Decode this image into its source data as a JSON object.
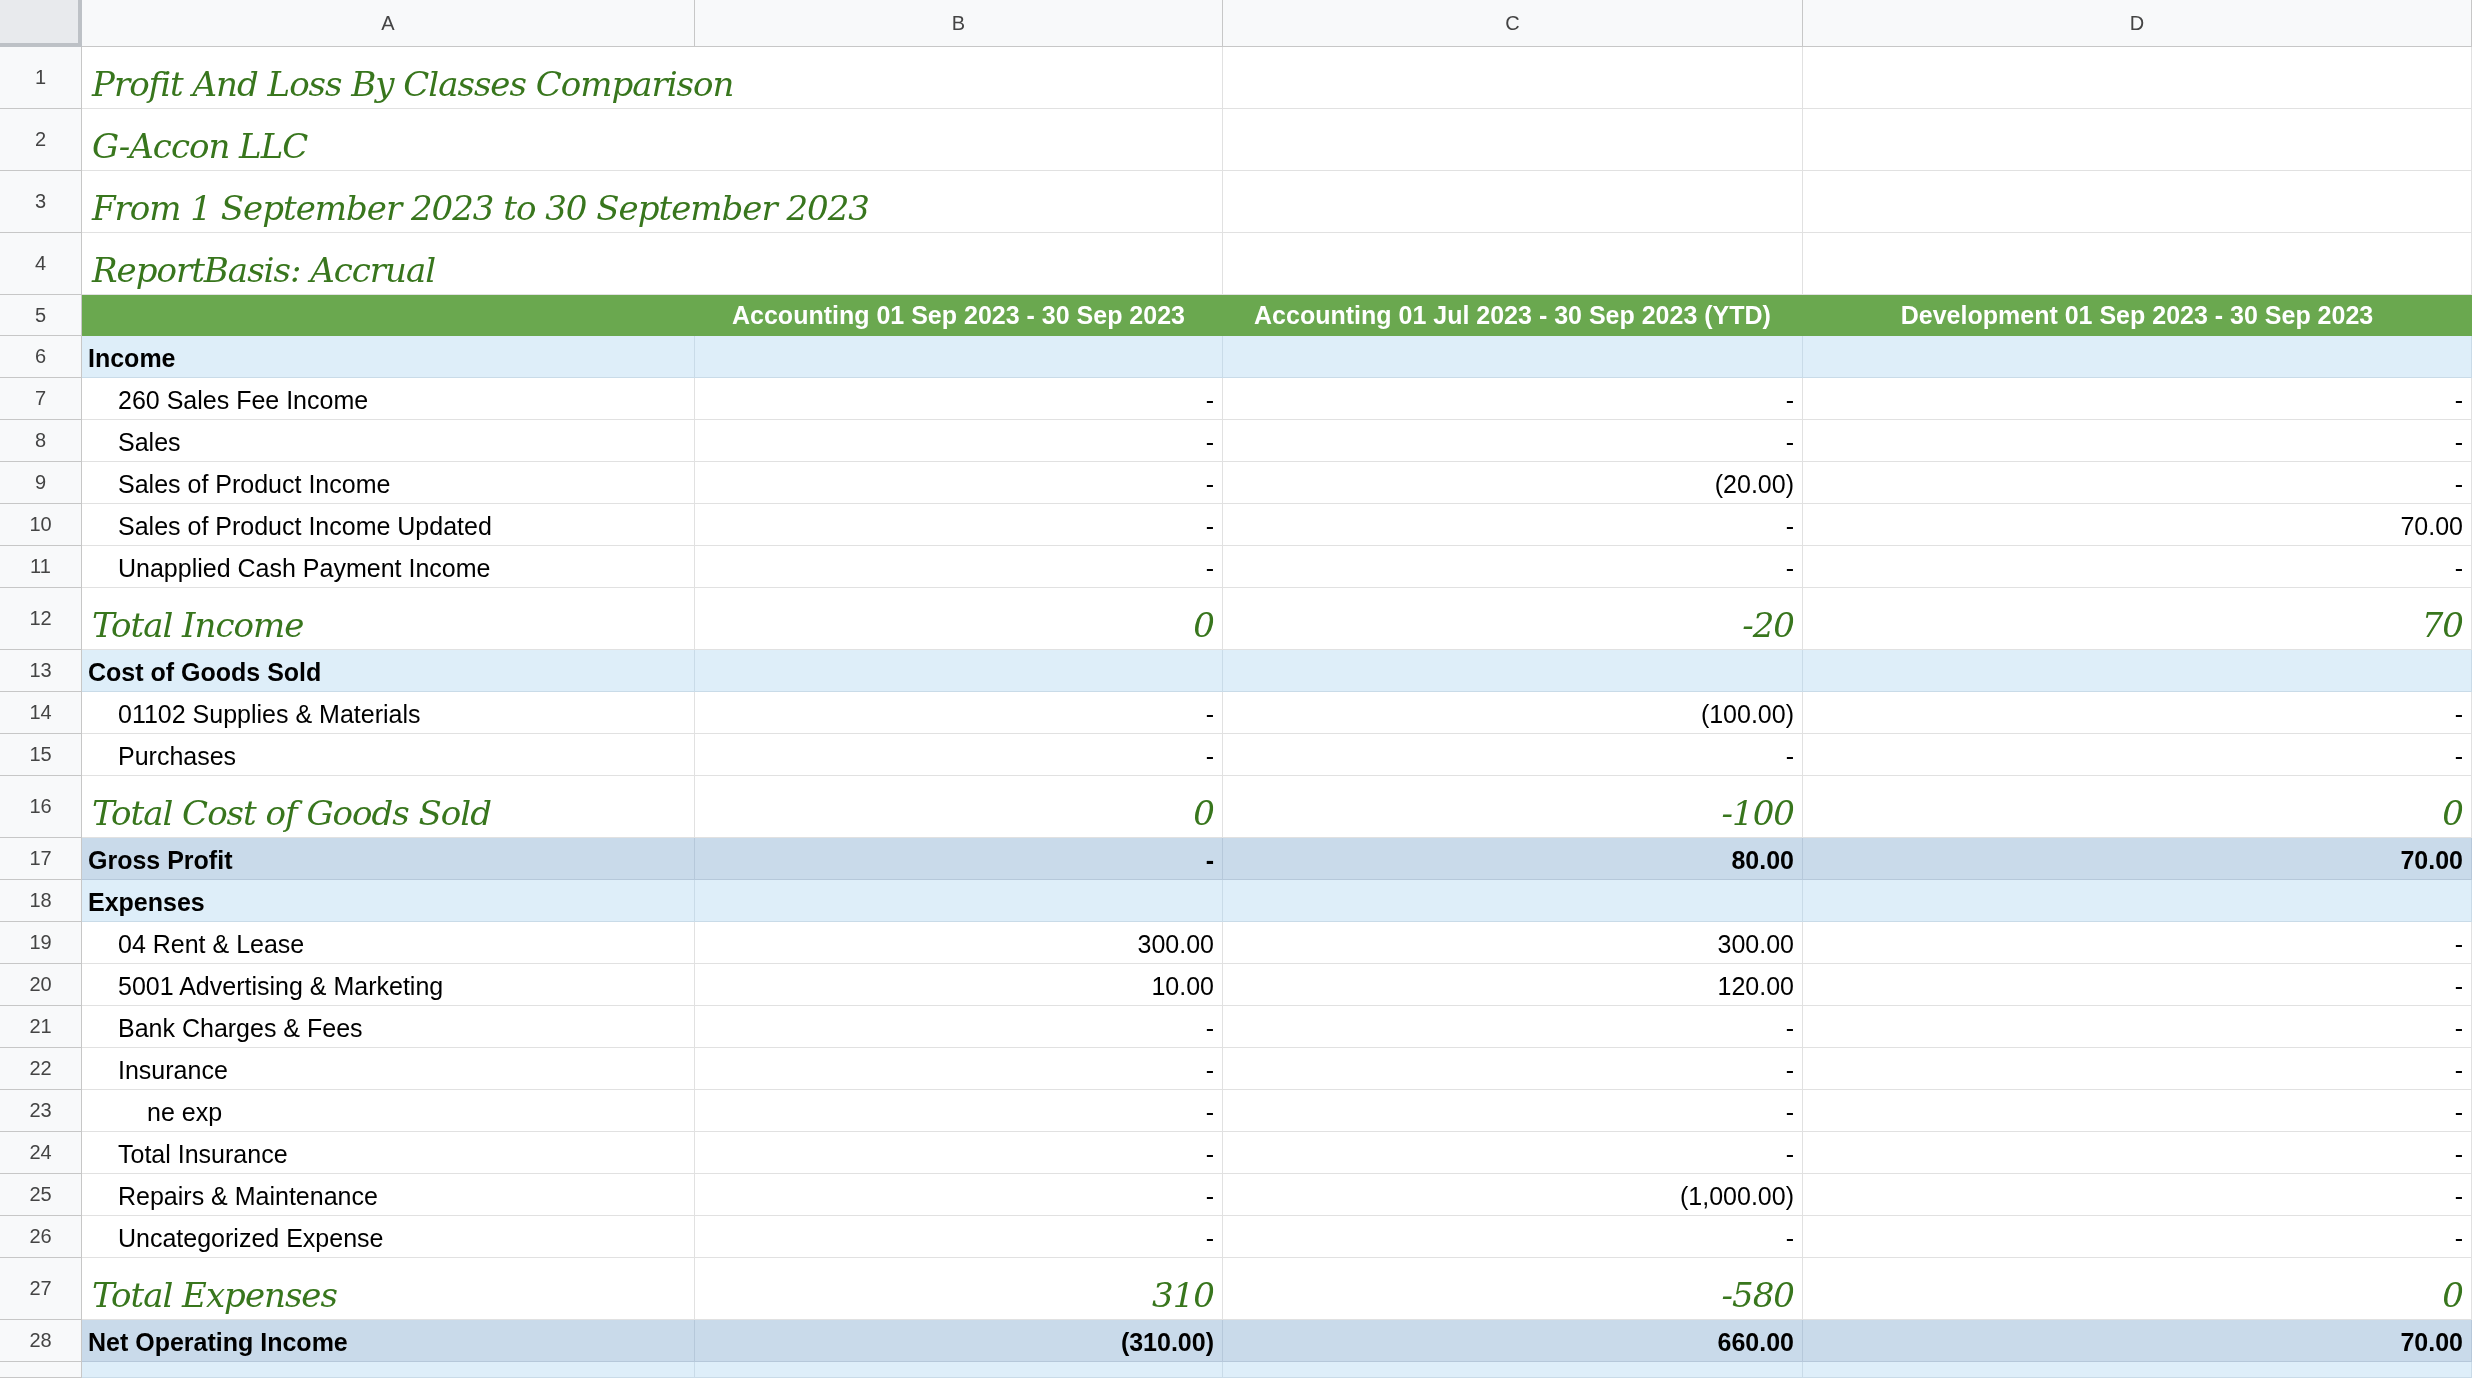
{
  "columns": [
    {
      "letter": "A"
    },
    {
      "letter": "B"
    },
    {
      "letter": "C"
    },
    {
      "letter": "D"
    }
  ],
  "rows": [
    {
      "number": "1",
      "kind": "title",
      "label": "Profit And Loss By Classes Comparison"
    },
    {
      "number": "2",
      "kind": "title",
      "label": "G-Accon LLC"
    },
    {
      "number": "3",
      "kind": "title",
      "label": "From 1 September 2023 to 30 September 2023"
    },
    {
      "number": "4",
      "kind": "title",
      "label": "ReportBasis: Accrual"
    },
    {
      "number": "5",
      "kind": "header",
      "cells": [
        "Accounting 01 Sep 2023 - 30 Sep 2023",
        "Accounting 01 Jul 2023 - 30 Sep 2023 (YTD)",
        "Development 01 Sep 2023 - 30 Sep 2023"
      ]
    },
    {
      "number": "6",
      "kind": "section",
      "label": "Income",
      "children": [
        {
          "number": "7",
          "kind": "item",
          "label": "260 Sales Fee Income",
          "cells": [
            "-",
            "-",
            "-"
          ]
        },
        {
          "number": "8",
          "kind": "item",
          "label": "Sales",
          "cells": [
            "-",
            "-",
            "-"
          ]
        },
        {
          "number": "9",
          "kind": "item",
          "label": "Sales of Product Income",
          "cells": [
            "-",
            "(20.00)",
            "-"
          ]
        },
        {
          "number": "10",
          "kind": "item",
          "label": "Sales of Product Income Updated",
          "cells": [
            "-",
            "-",
            "70.00"
          ]
        },
        {
          "number": "11",
          "kind": "item",
          "label": "Unapplied Cash Payment Income",
          "cells": [
            "-",
            "-",
            "-"
          ]
        }
      ]
    },
    {
      "number": "12",
      "kind": "total",
      "label": "Total Income",
      "cells": [
        "0",
        "-20",
        "70"
      ]
    },
    {
      "number": "13",
      "kind": "section",
      "label": "Cost of Goods Sold",
      "children": [
        {
          "number": "14",
          "kind": "item",
          "label": "01102 Supplies & Materials",
          "cells": [
            "-",
            "(100.00)",
            "-"
          ]
        },
        {
          "number": "15",
          "kind": "item",
          "label": "Purchases",
          "cells": [
            "-",
            "-",
            "-"
          ]
        }
      ]
    },
    {
      "number": "16",
      "kind": "total",
      "label": "Total Cost of Goods Sold",
      "cells": [
        "0",
        "-100",
        "0"
      ]
    },
    {
      "number": "17",
      "kind": "summary",
      "label": "Gross Profit",
      "cells": [
        "-",
        "80.00",
        "70.00"
      ]
    },
    {
      "number": "18",
      "kind": "section",
      "label": "Expenses",
      "children": [
        {
          "number": "19",
          "kind": "item",
          "label": "04 Rent & Lease",
          "cells": [
            "300.00",
            "300.00",
            "-"
          ]
        },
        {
          "number": "20",
          "kind": "item",
          "label": "5001 Advertising & Marketing",
          "cells": [
            "10.00",
            "120.00",
            "-"
          ]
        },
        {
          "number": "21",
          "kind": "item",
          "label": "Bank Charges & Fees",
          "cells": [
            "-",
            "-",
            "-"
          ]
        },
        {
          "number": "22",
          "kind": "item",
          "label": "Insurance",
          "cells": [
            "-",
            "-",
            "-"
          ],
          "children": [
            {
              "number": "23",
              "kind": "item",
              "label": "ne exp",
              "cells": [
                "-",
                "-",
                "-"
              ]
            }
          ]
        },
        {
          "number": "24",
          "kind": "item",
          "label": "Total Insurance",
          "cells": [
            "-",
            "-",
            "-"
          ]
        },
        {
          "number": "25",
          "kind": "item",
          "label": "Repairs & Maintenance",
          "cells": [
            "-",
            "(1,000.00)",
            "-"
          ]
        },
        {
          "number": "26",
          "kind": "item",
          "label": "Uncategorized Expense",
          "cells": [
            "-",
            "-",
            "-"
          ]
        }
      ]
    },
    {
      "number": "27",
      "kind": "total",
      "label": "Total Expenses",
      "cells": [
        "310",
        "-580",
        "0"
      ]
    },
    {
      "number": "28",
      "kind": "summary",
      "label": "Net Operating Income",
      "cells": [
        "(310.00)",
        "660.00",
        "70.00"
      ]
    },
    {
      "kind": "cut"
    }
  ]
}
